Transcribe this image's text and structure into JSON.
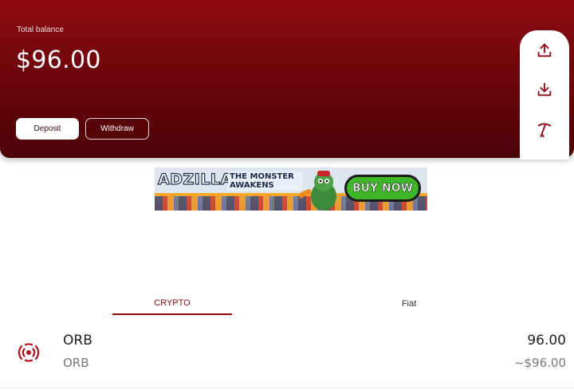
{
  "wallet": {
    "total_label": "Total balance",
    "total_amount": "$96.00",
    "deposit_label": "Deposit",
    "withdraw_label": "Withdraw"
  },
  "side_actions": [
    {
      "icon": "upload-icon"
    },
    {
      "icon": "download-icon"
    },
    {
      "icon": "pickaxe-icon"
    }
  ],
  "ad": {
    "title": "ADZILLA",
    "subtitle": "THE MONSTER AWAKENS",
    "cta": "BUY NOW"
  },
  "tabs": [
    {
      "label": "CRYPTO",
      "active": true
    },
    {
      "label": "Fiat",
      "active": false
    }
  ],
  "assets": [
    {
      "icon": "orb-icon",
      "name": "ORB",
      "symbol": "ORB",
      "amount": "96.00",
      "fiat_value": "~$96.00"
    }
  ],
  "colors": {
    "brand": "#8e0a12",
    "brand_dark": "#4c0307"
  }
}
